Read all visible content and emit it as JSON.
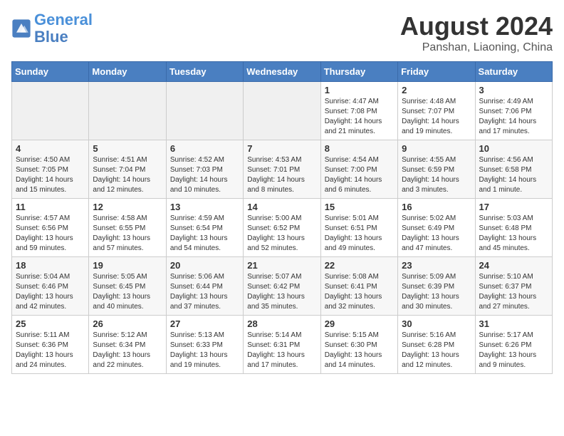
{
  "header": {
    "logo_line1": "General",
    "logo_line2": "Blue",
    "title": "August 2024",
    "subtitle": "Panshan, Liaoning, China"
  },
  "days_of_week": [
    "Sunday",
    "Monday",
    "Tuesday",
    "Wednesday",
    "Thursday",
    "Friday",
    "Saturday"
  ],
  "weeks": [
    [
      {
        "day": "",
        "info": ""
      },
      {
        "day": "",
        "info": ""
      },
      {
        "day": "",
        "info": ""
      },
      {
        "day": "",
        "info": ""
      },
      {
        "day": "1",
        "info": "Sunrise: 4:47 AM\nSunset: 7:08 PM\nDaylight: 14 hours\nand 21 minutes."
      },
      {
        "day": "2",
        "info": "Sunrise: 4:48 AM\nSunset: 7:07 PM\nDaylight: 14 hours\nand 19 minutes."
      },
      {
        "day": "3",
        "info": "Sunrise: 4:49 AM\nSunset: 7:06 PM\nDaylight: 14 hours\nand 17 minutes."
      }
    ],
    [
      {
        "day": "4",
        "info": "Sunrise: 4:50 AM\nSunset: 7:05 PM\nDaylight: 14 hours\nand 15 minutes."
      },
      {
        "day": "5",
        "info": "Sunrise: 4:51 AM\nSunset: 7:04 PM\nDaylight: 14 hours\nand 12 minutes."
      },
      {
        "day": "6",
        "info": "Sunrise: 4:52 AM\nSunset: 7:03 PM\nDaylight: 14 hours\nand 10 minutes."
      },
      {
        "day": "7",
        "info": "Sunrise: 4:53 AM\nSunset: 7:01 PM\nDaylight: 14 hours\nand 8 minutes."
      },
      {
        "day": "8",
        "info": "Sunrise: 4:54 AM\nSunset: 7:00 PM\nDaylight: 14 hours\nand 6 minutes."
      },
      {
        "day": "9",
        "info": "Sunrise: 4:55 AM\nSunset: 6:59 PM\nDaylight: 14 hours\nand 3 minutes."
      },
      {
        "day": "10",
        "info": "Sunrise: 4:56 AM\nSunset: 6:58 PM\nDaylight: 14 hours\nand 1 minute."
      }
    ],
    [
      {
        "day": "11",
        "info": "Sunrise: 4:57 AM\nSunset: 6:56 PM\nDaylight: 13 hours\nand 59 minutes."
      },
      {
        "day": "12",
        "info": "Sunrise: 4:58 AM\nSunset: 6:55 PM\nDaylight: 13 hours\nand 57 minutes."
      },
      {
        "day": "13",
        "info": "Sunrise: 4:59 AM\nSunset: 6:54 PM\nDaylight: 13 hours\nand 54 minutes."
      },
      {
        "day": "14",
        "info": "Sunrise: 5:00 AM\nSunset: 6:52 PM\nDaylight: 13 hours\nand 52 minutes."
      },
      {
        "day": "15",
        "info": "Sunrise: 5:01 AM\nSunset: 6:51 PM\nDaylight: 13 hours\nand 49 minutes."
      },
      {
        "day": "16",
        "info": "Sunrise: 5:02 AM\nSunset: 6:49 PM\nDaylight: 13 hours\nand 47 minutes."
      },
      {
        "day": "17",
        "info": "Sunrise: 5:03 AM\nSunset: 6:48 PM\nDaylight: 13 hours\nand 45 minutes."
      }
    ],
    [
      {
        "day": "18",
        "info": "Sunrise: 5:04 AM\nSunset: 6:46 PM\nDaylight: 13 hours\nand 42 minutes."
      },
      {
        "day": "19",
        "info": "Sunrise: 5:05 AM\nSunset: 6:45 PM\nDaylight: 13 hours\nand 40 minutes."
      },
      {
        "day": "20",
        "info": "Sunrise: 5:06 AM\nSunset: 6:44 PM\nDaylight: 13 hours\nand 37 minutes."
      },
      {
        "day": "21",
        "info": "Sunrise: 5:07 AM\nSunset: 6:42 PM\nDaylight: 13 hours\nand 35 minutes."
      },
      {
        "day": "22",
        "info": "Sunrise: 5:08 AM\nSunset: 6:41 PM\nDaylight: 13 hours\nand 32 minutes."
      },
      {
        "day": "23",
        "info": "Sunrise: 5:09 AM\nSunset: 6:39 PM\nDaylight: 13 hours\nand 30 minutes."
      },
      {
        "day": "24",
        "info": "Sunrise: 5:10 AM\nSunset: 6:37 PM\nDaylight: 13 hours\nand 27 minutes."
      }
    ],
    [
      {
        "day": "25",
        "info": "Sunrise: 5:11 AM\nSunset: 6:36 PM\nDaylight: 13 hours\nand 24 minutes."
      },
      {
        "day": "26",
        "info": "Sunrise: 5:12 AM\nSunset: 6:34 PM\nDaylight: 13 hours\nand 22 minutes."
      },
      {
        "day": "27",
        "info": "Sunrise: 5:13 AM\nSunset: 6:33 PM\nDaylight: 13 hours\nand 19 minutes."
      },
      {
        "day": "28",
        "info": "Sunrise: 5:14 AM\nSunset: 6:31 PM\nDaylight: 13 hours\nand 17 minutes."
      },
      {
        "day": "29",
        "info": "Sunrise: 5:15 AM\nSunset: 6:30 PM\nDaylight: 13 hours\nand 14 minutes."
      },
      {
        "day": "30",
        "info": "Sunrise: 5:16 AM\nSunset: 6:28 PM\nDaylight: 13 hours\nand 12 minutes."
      },
      {
        "day": "31",
        "info": "Sunrise: 5:17 AM\nSunset: 6:26 PM\nDaylight: 13 hours\nand 9 minutes."
      }
    ]
  ]
}
